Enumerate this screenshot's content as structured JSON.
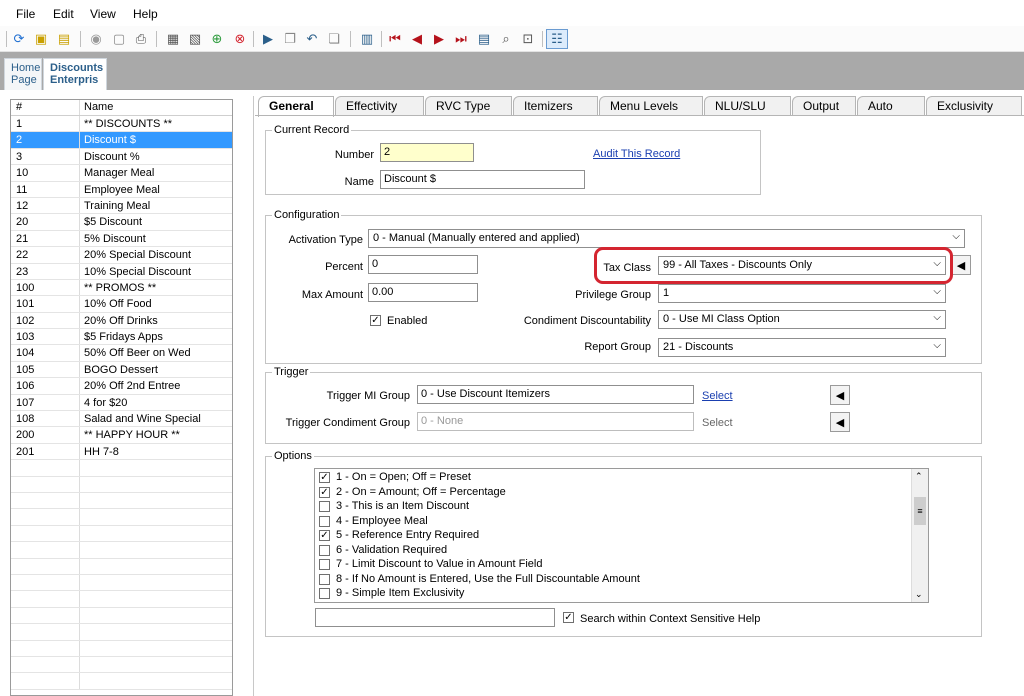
{
  "menu": [
    "File",
    "Edit",
    "View",
    "Help"
  ],
  "page_tabs": {
    "home": [
      "Home",
      "Page"
    ],
    "active": [
      "Discounts",
      "Enterpris"
    ]
  },
  "list": {
    "headers": {
      "num": "#",
      "name": "Name"
    },
    "rows": [
      {
        "num": "1",
        "name": "** DISCOUNTS **"
      },
      {
        "num": "2",
        "name": "Discount $"
      },
      {
        "num": "3",
        "name": "Discount %"
      },
      {
        "num": "10",
        "name": "Manager Meal"
      },
      {
        "num": "11",
        "name": "Employee Meal"
      },
      {
        "num": "12",
        "name": "Training Meal"
      },
      {
        "num": "20",
        "name": "$5 Discount"
      },
      {
        "num": "21",
        "name": "5% Discount"
      },
      {
        "num": "22",
        "name": "20% Special Discount"
      },
      {
        "num": "23",
        "name": "10% Special Discount"
      },
      {
        "num": "100",
        "name": "** PROMOS **"
      },
      {
        "num": "101",
        "name": "10% Off Food"
      },
      {
        "num": "102",
        "name": "20% Off Drinks"
      },
      {
        "num": "103",
        "name": "$5 Fridays Apps"
      },
      {
        "num": "104",
        "name": "50% Off Beer on Wed"
      },
      {
        "num": "105",
        "name": "BOGO Dessert"
      },
      {
        "num": "106",
        "name": "20% Off 2nd Entree"
      },
      {
        "num": "107",
        "name": "4 for $20"
      },
      {
        "num": "108",
        "name": "Salad and Wine Special"
      },
      {
        "num": "200",
        "name": "** HAPPY HOUR **"
      },
      {
        "num": "201",
        "name": "HH 7-8"
      }
    ],
    "selected_index": 1
  },
  "tabs": [
    "General",
    "Effectivity",
    "RVC Type",
    "Itemizers",
    "Menu Levels",
    "NLU/SLU",
    "Output",
    "Auto",
    "Exclusivity"
  ],
  "current_record": {
    "legend": "Current Record",
    "number_label": "Number",
    "number_value": "2",
    "name_label": "Name",
    "name_value": "Discount $",
    "audit_link": "Audit This Record"
  },
  "configuration": {
    "legend": "Configuration",
    "activation_type_label": "Activation Type",
    "activation_type_value": "0 - Manual (Manually entered and applied)",
    "percent_label": "Percent",
    "percent_value": "0",
    "max_amount_label": "Max Amount",
    "max_amount_value": "0.00",
    "enabled_label": "Enabled",
    "tax_class_label": "Tax Class",
    "tax_class_value": "99 - All Taxes - Discounts Only",
    "privilege_group_label": "Privilege Group",
    "privilege_group_value": "1",
    "condiment_label": "Condiment Discountability",
    "condiment_value": "0 - Use MI Class Option",
    "report_group_label": "Report Group",
    "report_group_value": "21 - Discounts"
  },
  "trigger": {
    "legend": "Trigger",
    "mi_group_label": "Trigger MI Group",
    "mi_group_value": "0 - Use Discount Itemizers",
    "mi_select": "Select",
    "condiment_group_label": "Trigger Condiment Group",
    "condiment_group_value": "0 - None",
    "condiment_select": "Select"
  },
  "options": {
    "legend": "Options",
    "items": [
      {
        "label": "1 - On = Open; Off = Preset",
        "checked": true
      },
      {
        "label": "2 - On = Amount; Off = Percentage",
        "checked": true
      },
      {
        "label": "3 - This is an Item Discount",
        "checked": false
      },
      {
        "label": "4 - Employee Meal",
        "checked": false
      },
      {
        "label": "5 - Reference Entry Required",
        "checked": true
      },
      {
        "label": "6 - Validation Required",
        "checked": false
      },
      {
        "label": "7 - Limit Discount to Value in Amount Field",
        "checked": false
      },
      {
        "label": "8 - If No Amount is Entered, Use the Full Discountable Amount",
        "checked": false
      },
      {
        "label": "9 - Simple Item Exclusivity",
        "checked": false
      }
    ],
    "search_label": "Search within Context Sensitive Help",
    "search_checked": true
  },
  "colors": {
    "selection": "#3399ff",
    "highlight": "#d42530",
    "link": "#1a3fb0"
  }
}
